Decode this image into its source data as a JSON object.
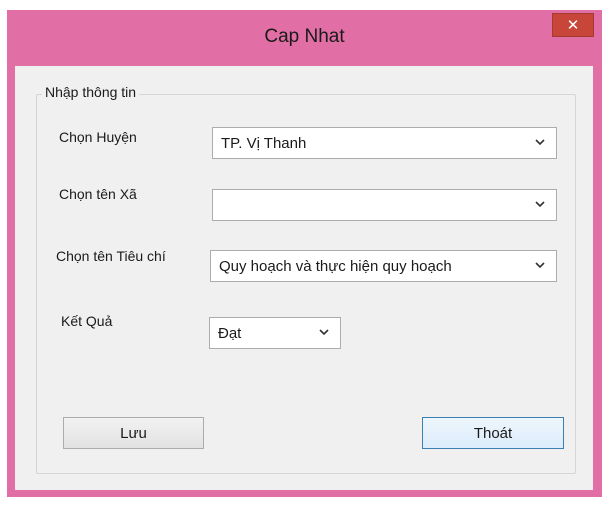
{
  "window": {
    "title": "Cap Nhat",
    "close_symbol": "✕"
  },
  "group": {
    "legend": "Nhập thông tin"
  },
  "fields": {
    "huyen": {
      "label": "Chọn Huyện",
      "value": "TP. Vị Thanh"
    },
    "xa": {
      "label": "Chọn tên Xã",
      "value": ""
    },
    "tieuchi": {
      "label": "Chọn tên Tiêu chí",
      "value": "Quy hoạch và thực hiện quy hoạch"
    },
    "ketqua": {
      "label": "Kết Quả",
      "value": "Đạt"
    }
  },
  "buttons": {
    "save": "Lưu",
    "exit": "Thoát"
  },
  "colors": {
    "titlebar": "#e16fa5",
    "close": "#c8453a",
    "client": "#f0f0f0"
  }
}
